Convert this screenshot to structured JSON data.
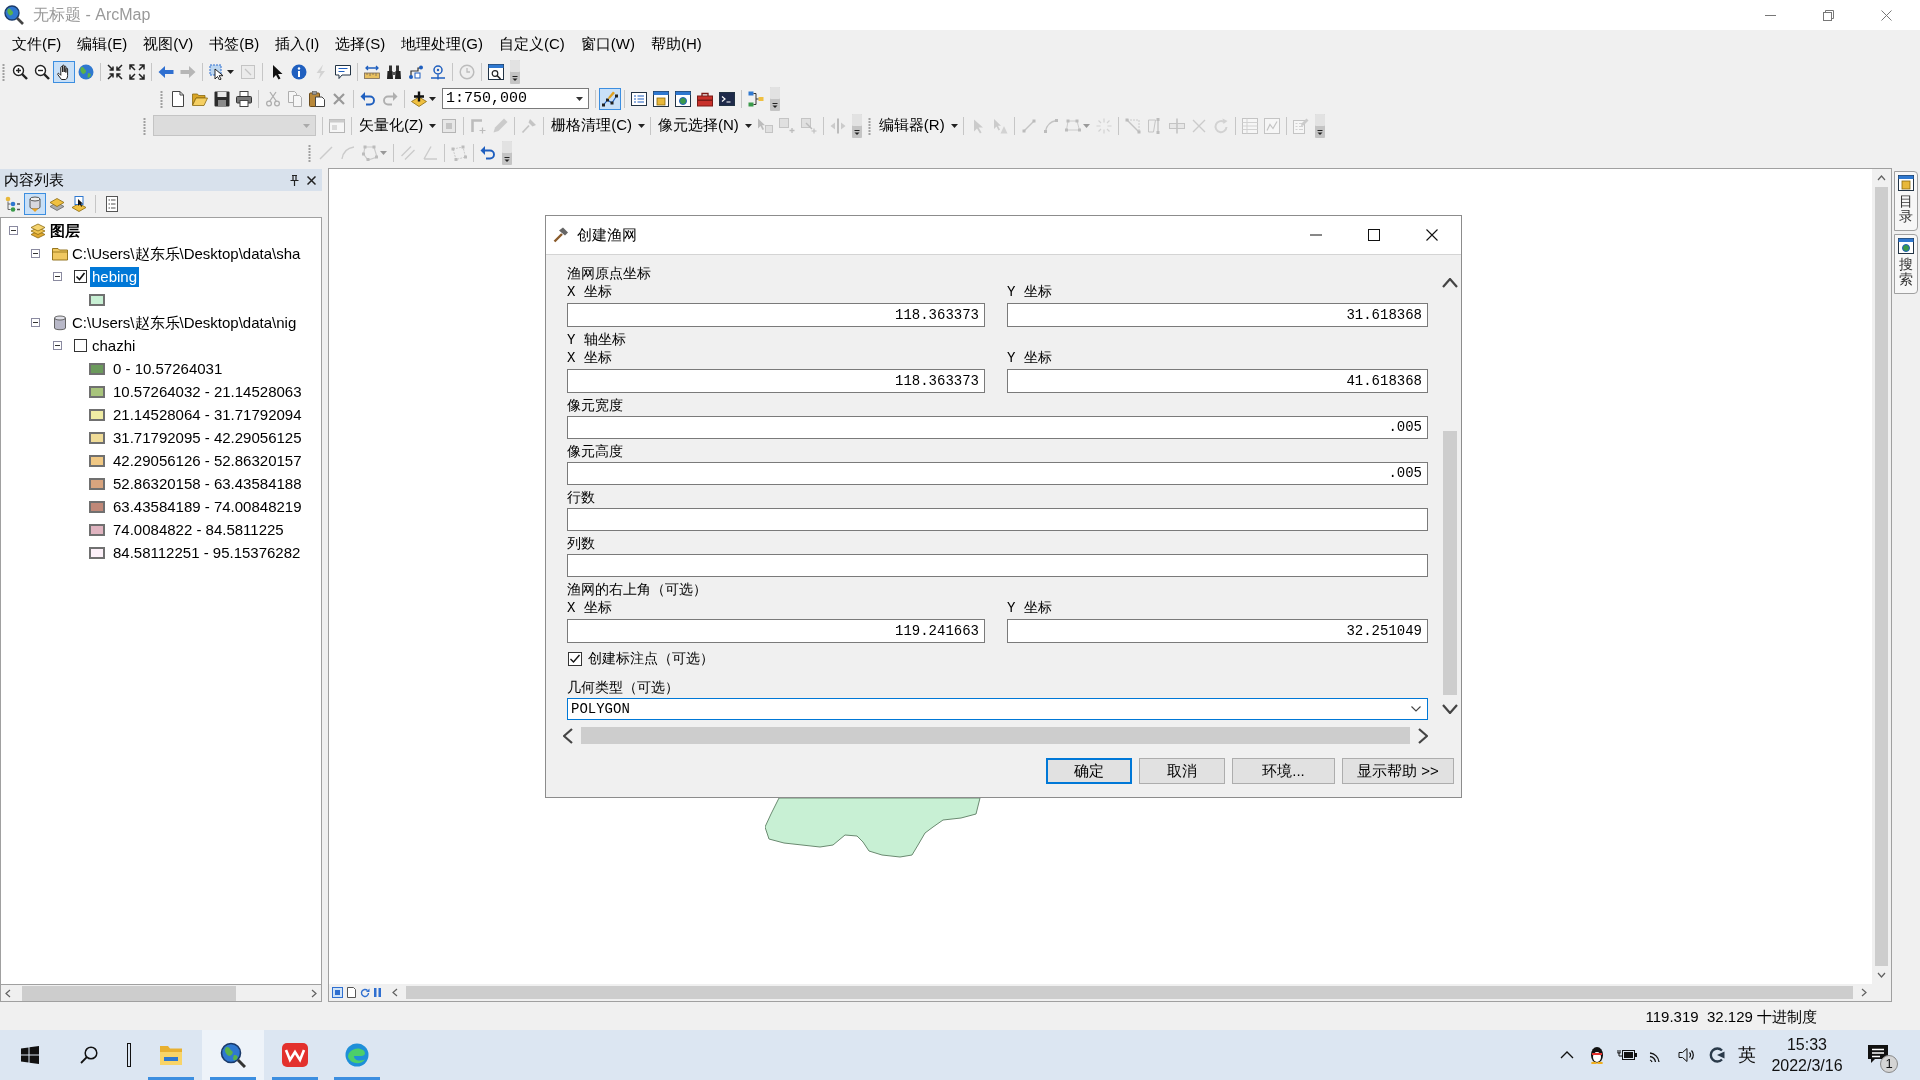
{
  "window": {
    "title": "无标题 - ArcMap",
    "active": false
  },
  "menu": [
    "文件(F)",
    "编辑(E)",
    "视图(V)",
    "书签(B)",
    "插入(I)",
    "选择(S)",
    "地理处理(G)",
    "自定义(C)",
    "窗口(W)",
    "帮助(H)"
  ],
  "toolbars": [
    {
      "groups": [
        [
          {
            "kind": "zoomin",
            "selected": false,
            "disabled": false
          },
          {
            "kind": "zoomout",
            "selected": false,
            "disabled": false
          },
          {
            "kind": "pan",
            "selected": true,
            "disabled": false
          },
          {
            "kind": "fullextent",
            "selected": false,
            "disabled": false
          }
        ],
        [
          {
            "kind": "fixedzoomin",
            "selected": false,
            "disabled": false
          },
          {
            "kind": "fixedzoomout",
            "selected": false,
            "disabled": false
          }
        ],
        [
          {
            "kind": "back",
            "selected": false,
            "disabled": false
          },
          {
            "kind": "forward",
            "selected": false,
            "disabled": true
          }
        ],
        [
          {
            "kind": "selectfeatures",
            "selected": false,
            "disabled": false,
            "dropdown": true
          },
          {
            "kind": "clearselection",
            "selected": false,
            "disabled": true
          }
        ],
        [
          {
            "kind": "pointer",
            "selected": false,
            "disabled": false
          },
          {
            "kind": "identify",
            "selected": false,
            "disabled": false
          },
          {
            "kind": "hyperlink",
            "selected": false,
            "disabled": true
          },
          {
            "kind": "popup",
            "selected": false,
            "disabled": false
          }
        ],
        [
          {
            "kind": "measure",
            "selected": false,
            "disabled": false
          },
          {
            "kind": "find",
            "selected": false,
            "disabled": false
          },
          {
            "kind": "route",
            "selected": false,
            "disabled": false
          },
          {
            "kind": "gotoxy",
            "selected": false,
            "disabled": false
          }
        ],
        [
          {
            "kind": "timeslider",
            "selected": false,
            "disabled": true
          }
        ],
        [
          {
            "kind": "viewer",
            "selected": false,
            "disabled": false
          }
        ]
      ]
    },
    {
      "groups": [
        [
          {
            "kind": "newdoc",
            "selected": false,
            "disabled": false
          },
          {
            "kind": "open",
            "selected": false,
            "disabled": false
          },
          {
            "kind": "save",
            "selected": false,
            "disabled": false
          },
          {
            "kind": "print",
            "selected": false,
            "disabled": false
          }
        ],
        [
          {
            "kind": "cut",
            "selected": false,
            "disabled": true
          },
          {
            "kind": "copy",
            "selected": false,
            "disabled": true
          },
          {
            "kind": "paste",
            "selected": false,
            "disabled": false
          },
          {
            "kind": "delete",
            "selected": false,
            "disabled": true
          }
        ],
        [
          {
            "kind": "undo",
            "selected": false,
            "disabled": false
          },
          {
            "kind": "redo",
            "selected": false,
            "disabled": true
          }
        ],
        [
          {
            "kind": "adddata",
            "selected": false,
            "disabled": false,
            "dropdown": true
          },
          {
            "kind": "scale",
            "value": "1:750,000"
          }
        ],
        [
          {
            "kind": "editortoolbar",
            "selected": true,
            "disabled": false
          }
        ],
        [
          {
            "kind": "toc",
            "selected": false,
            "disabled": false
          },
          {
            "kind": "catalog",
            "selected": false,
            "disabled": false
          },
          {
            "kind": "searchwin",
            "selected": false,
            "disabled": false
          },
          {
            "kind": "toolbox",
            "selected": false,
            "disabled": false
          },
          {
            "kind": "python",
            "selected": false,
            "disabled": false
          }
        ],
        [
          {
            "kind": "modelbuilder",
            "selected": false,
            "disabled": false
          }
        ]
      ]
    },
    {
      "groups": [
        [
          {
            "kind": "layer",
            "disabled": true
          }
        ],
        [
          {
            "kind": "rasterprops",
            "selected": false,
            "disabled": true
          }
        ],
        [
          {
            "kind": "menu",
            "label": "矢量化(Z)",
            "dropdown": true,
            "selected": false,
            "disabled": false
          },
          {
            "kind": "vectsettings",
            "selected": false,
            "disabled": true
          }
        ],
        [
          {
            "kind": "lineplus",
            "selected": false,
            "disabled": true
          },
          {
            "kind": "pencil",
            "selected": false,
            "disabled": true
          }
        ],
        [
          {
            "kind": "brush",
            "selected": false,
            "disabled": true
          }
        ],
        [
          {
            "kind": "menu",
            "label": "栅格清理(C)",
            "dropdown": true,
            "selected": false,
            "disabled": false
          }
        ],
        [
          {
            "kind": "menu",
            "label": "像元选择(N)",
            "dropdown": true,
            "selected": false,
            "disabled": false
          },
          {
            "kind": "cellselect",
            "selected": false,
            "disabled": true
          },
          {
            "kind": "cellselectplus",
            "selected": false,
            "disabled": true
          },
          {
            "kind": "cellselectcorner",
            "selected": false,
            "disabled": true
          }
        ],
        [
          {
            "kind": "splitbar",
            "selected": false,
            "disabled": true
          }
        ]
      ]
    },
    {
      "groups": [
        [
          {
            "kind": "menu",
            "label": "编辑器(R)",
            "dropdown": true,
            "selected": false,
            "disabled": false
          }
        ],
        [
          {
            "kind": "editpointer",
            "selected": false,
            "disabled": true
          },
          {
            "kind": "annotpointer",
            "selected": false,
            "disabled": true
          }
        ],
        [
          {
            "kind": "straightseg",
            "selected": false,
            "disabled": true
          },
          {
            "kind": "arcseg",
            "selected": false,
            "disabled": true
          },
          {
            "kind": "tracepoly",
            "selected": false,
            "disabled": true,
            "dropdown": true
          },
          {
            "kind": "pointburst",
            "selected": false,
            "disabled": true
          }
        ],
        [
          {
            "kind": "reshape",
            "selected": false,
            "disabled": true
          },
          {
            "kind": "cutpolygon",
            "selected": false,
            "disabled": true
          },
          {
            "kind": "split",
            "selected": false,
            "disabled": true
          },
          {
            "kind": "intersect",
            "selected": false,
            "disabled": true
          },
          {
            "kind": "rotate",
            "selected": false,
            "disabled": true
          }
        ],
        [
          {
            "kind": "attributes",
            "selected": false,
            "disabled": true
          },
          {
            "kind": "sketchprops",
            "selected": false,
            "disabled": true
          }
        ],
        [
          {
            "kind": "createfeatures",
            "selected": false,
            "disabled": true
          }
        ]
      ]
    },
    {
      "groups": [
        [
          {
            "kind": "line",
            "selected": false,
            "disabled": true
          },
          {
            "kind": "arc",
            "selected": false,
            "disabled": true
          },
          {
            "kind": "polygon",
            "selected": false,
            "disabled": true,
            "dropdown": true
          }
        ],
        [
          {
            "kind": "parallel",
            "selected": false,
            "disabled": true
          },
          {
            "kind": "angle",
            "selected": false,
            "disabled": true
          }
        ],
        [
          {
            "kind": "polycorner",
            "selected": false,
            "disabled": true
          }
        ],
        [
          {
            "kind": "undo",
            "selected": false,
            "disabled": false
          }
        ]
      ]
    }
  ],
  "contents": {
    "title": "内容列表",
    "views": [
      {
        "kind": "drawingorder",
        "selected": false
      },
      {
        "kind": "source",
        "selected": true
      },
      {
        "kind": "visibility",
        "selected": false
      },
      {
        "kind": "selection",
        "selected": false
      },
      {
        "kind": "options",
        "selected": false
      }
    ],
    "tree": [
      {
        "kind": "frame",
        "label": "图层",
        "expanded": true,
        "selected": false,
        "children": [
          {
            "kind": "folder",
            "label": "C:\\Users\\赵东乐\\Desktop\\data\\sha",
            "expanded": true,
            "selected": false,
            "children": [
              {
                "kind": "layer",
                "label": "hebing",
                "expanded": true,
                "checked": true,
                "selected": true,
                "children": [
                  {
                    "kind": "class",
                    "color": "#c8f0d4"
                  }
                ]
              }
            ]
          },
          {
            "kind": "database",
            "label": "C:\\Users\\赵东乐\\Desktop\\data\\nig",
            "expanded": true,
            "selected": false,
            "children": [
              {
                "kind": "layer",
                "label": "chazhi",
                "expanded": true,
                "checked": false,
                "selected": false,
                "children": [
                  {
                    "kind": "class",
                    "label": "0 - 10.57264031",
                    "color": "#6b9a5c"
                  },
                  {
                    "kind": "class",
                    "label": "10.57264032 - 21.14528063",
                    "color": "#a8c47c"
                  },
                  {
                    "kind": "class",
                    "label": "21.14528064 - 31.71792094",
                    "color": "#f0eca4"
                  },
                  {
                    "kind": "class",
                    "label": "31.71792095 - 42.29056125",
                    "color": "#f0dc98"
                  },
                  {
                    "kind": "class",
                    "label": "42.29056126 - 52.86320157",
                    "color": "#f0c884"
                  },
                  {
                    "kind": "class",
                    "label": "52.86320158 - 63.43584188",
                    "color": "#d8a47e"
                  },
                  {
                    "kind": "class",
                    "label": "63.43584189 - 74.00848219",
                    "color": "#c08878"
                  },
                  {
                    "kind": "class",
                    "label": "74.0084822 - 84.5811225",
                    "color": "#e0b4c0"
                  },
                  {
                    "kind": "class",
                    "label": "84.58112251 - 95.15376282",
                    "color": "#fcf0f8"
                  }
                ]
              }
            ]
          }
        ]
      }
    ]
  },
  "side_tabs": [
    {
      "kind": "cabinet",
      "label": "目录"
    },
    {
      "kind": "globe",
      "label": "搜索"
    }
  ],
  "dialog": {
    "title": "创建渔网",
    "active": true,
    "rows": [
      {
        "kind": "heading",
        "label": "渔网原点坐标"
      },
      {
        "kind": "pair",
        "fields": [
          {
            "label": "X 坐标",
            "value": "118.363373"
          },
          {
            "label": "Y 坐标",
            "value": "31.618368"
          }
        ]
      },
      {
        "kind": "heading",
        "label": "Y 轴坐标"
      },
      {
        "kind": "pair",
        "fields": [
          {
            "label": "X 坐标",
            "value": "118.363373"
          },
          {
            "label": "Y 坐标",
            "value": "41.618368"
          }
        ]
      },
      {
        "kind": "field",
        "label": "像元宽度",
        "value": ".005"
      },
      {
        "kind": "field",
        "label": "像元高度",
        "value": ".005"
      },
      {
        "kind": "field",
        "label": "行数"
      },
      {
        "kind": "field",
        "label": "列数"
      },
      {
        "kind": "heading",
        "label": "渔网的右上角（可选）"
      },
      {
        "kind": "pair",
        "fields": [
          {
            "label": "X 坐标",
            "value": "119.241663"
          },
          {
            "label": "Y 坐标",
            "value": "32.251049"
          }
        ]
      },
      {
        "kind": "checkbox",
        "label": "创建标注点（可选）",
        "checked": true
      },
      {
        "kind": "select",
        "label": "几何类型（可选）",
        "value": "POLYGON",
        "focused": true
      }
    ],
    "buttons": [
      {
        "label": "确定",
        "default": true
      },
      {
        "label": "取消",
        "default": false
      },
      {
        "label": "环境...",
        "default": false
      },
      {
        "label": "显示帮助 >>",
        "default": false
      }
    ]
  },
  "status_bar": {
    "text": "119.319  32.129 十进制度"
  },
  "taskbar": {
    "apps": [
      {
        "kind": "folder",
        "running": true,
        "selected": false
      },
      {
        "kind": "globe",
        "running": true,
        "selected": true
      },
      {
        "kind": "redtile",
        "running": true,
        "selected": false
      },
      {
        "kind": "swirl",
        "running": true,
        "selected": false
      }
    ],
    "input_method": "英",
    "time": "15:33",
    "date": "2022/3/16",
    "notification_count": "1"
  }
}
